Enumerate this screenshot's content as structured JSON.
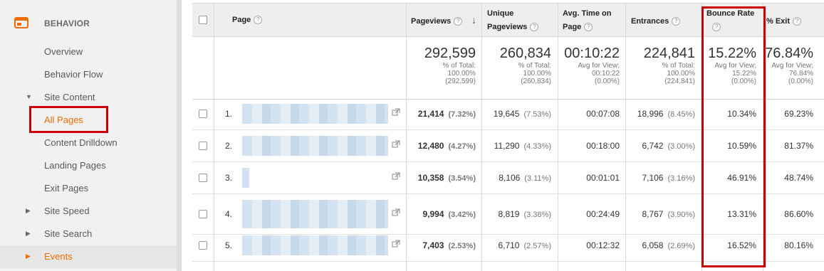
{
  "sidebar": {
    "section_title": "BEHAVIOR",
    "items": [
      {
        "label": "Overview"
      },
      {
        "label": "Behavior Flow"
      },
      {
        "label": "Site Content",
        "arrow": "▼"
      },
      {
        "label": "All Pages"
      },
      {
        "label": "Content Drilldown"
      },
      {
        "label": "Landing Pages"
      },
      {
        "label": "Exit Pages"
      },
      {
        "label": "Site Speed",
        "arrow": "▶"
      },
      {
        "label": "Site Search",
        "arrow": "▶"
      },
      {
        "label": "Events",
        "arrow": "▶"
      }
    ]
  },
  "table": {
    "headers": {
      "page": "Page",
      "pageviews": "Pageviews",
      "unique1": "Unique",
      "unique2": "Pageviews",
      "avgtime1": "Avg. Time on",
      "avgtime2": "Page",
      "entrances": "Entrances",
      "bounce": "Bounce Rate",
      "exit": "% Exit",
      "help": "?",
      "sort_arrow": "↓"
    },
    "totals": {
      "pageviews": {
        "big": "292,599",
        "l1": "% of Total:",
        "l2": "100.00%",
        "l3": "(292,599)"
      },
      "unique": {
        "big": "260,834",
        "l1": "% of Total:",
        "l2": "100.00%",
        "l3": "(260,834)"
      },
      "avgtime": {
        "big": "00:10:22",
        "l1": "Avg for View:",
        "l2": "00:10:22",
        "l3": "(0.00%)"
      },
      "entrances": {
        "big": "224,841",
        "l1": "% of Total:",
        "l2": "100.00%",
        "l3": "(224,841)"
      },
      "bounce": {
        "big": "15.22%",
        "l1": "Avg for View:",
        "l2": "15.22%",
        "l3": "(0.00%)"
      },
      "exit": {
        "big": "76.84%",
        "l1": "Avg for View:",
        "l2": "76.84%",
        "l3": "(0.00%)"
      }
    },
    "rows": [
      {
        "num": "1.",
        "pv": "21,414",
        "pv_pct": "(7.32%)",
        "up": "19,645",
        "up_pct": "(7.53%)",
        "time": "00:07:08",
        "ent": "18,996",
        "ent_pct": "(8.45%)",
        "bounce": "10.34%",
        "exit": "69.23%"
      },
      {
        "num": "2.",
        "pv": "12,480",
        "pv_pct": "(4.27%)",
        "up": "11,290",
        "up_pct": "(4.33%)",
        "time": "00:18:00",
        "ent": "6,742",
        "ent_pct": "(3.00%)",
        "bounce": "10.59%",
        "exit": "81.37%"
      },
      {
        "num": "3.",
        "pv": "10,358",
        "pv_pct": "(3.54%)",
        "up": "8,106",
        "up_pct": "(3.11%)",
        "time": "00:01:01",
        "ent": "7,106",
        "ent_pct": "(3.16%)",
        "bounce": "46.91%",
        "exit": "48.74%"
      },
      {
        "num": "4.",
        "pv": "9,994",
        "pv_pct": "(3.42%)",
        "up": "8,819",
        "up_pct": "(3.38%)",
        "time": "00:24:49",
        "ent": "8,767",
        "ent_pct": "(3.90%)",
        "bounce": "13.31%",
        "exit": "86.60%"
      },
      {
        "num": "5.",
        "pv": "7,403",
        "pv_pct": "(2.53%)",
        "up": "6,710",
        "up_pct": "(2.57%)",
        "time": "00:12:32",
        "ent": "6,058",
        "ent_pct": "(2.69%)",
        "bounce": "16.52%",
        "exit": "80.16%"
      }
    ]
  },
  "colors": {
    "accent": "#ef6c00",
    "highlight": "#cc0000"
  }
}
